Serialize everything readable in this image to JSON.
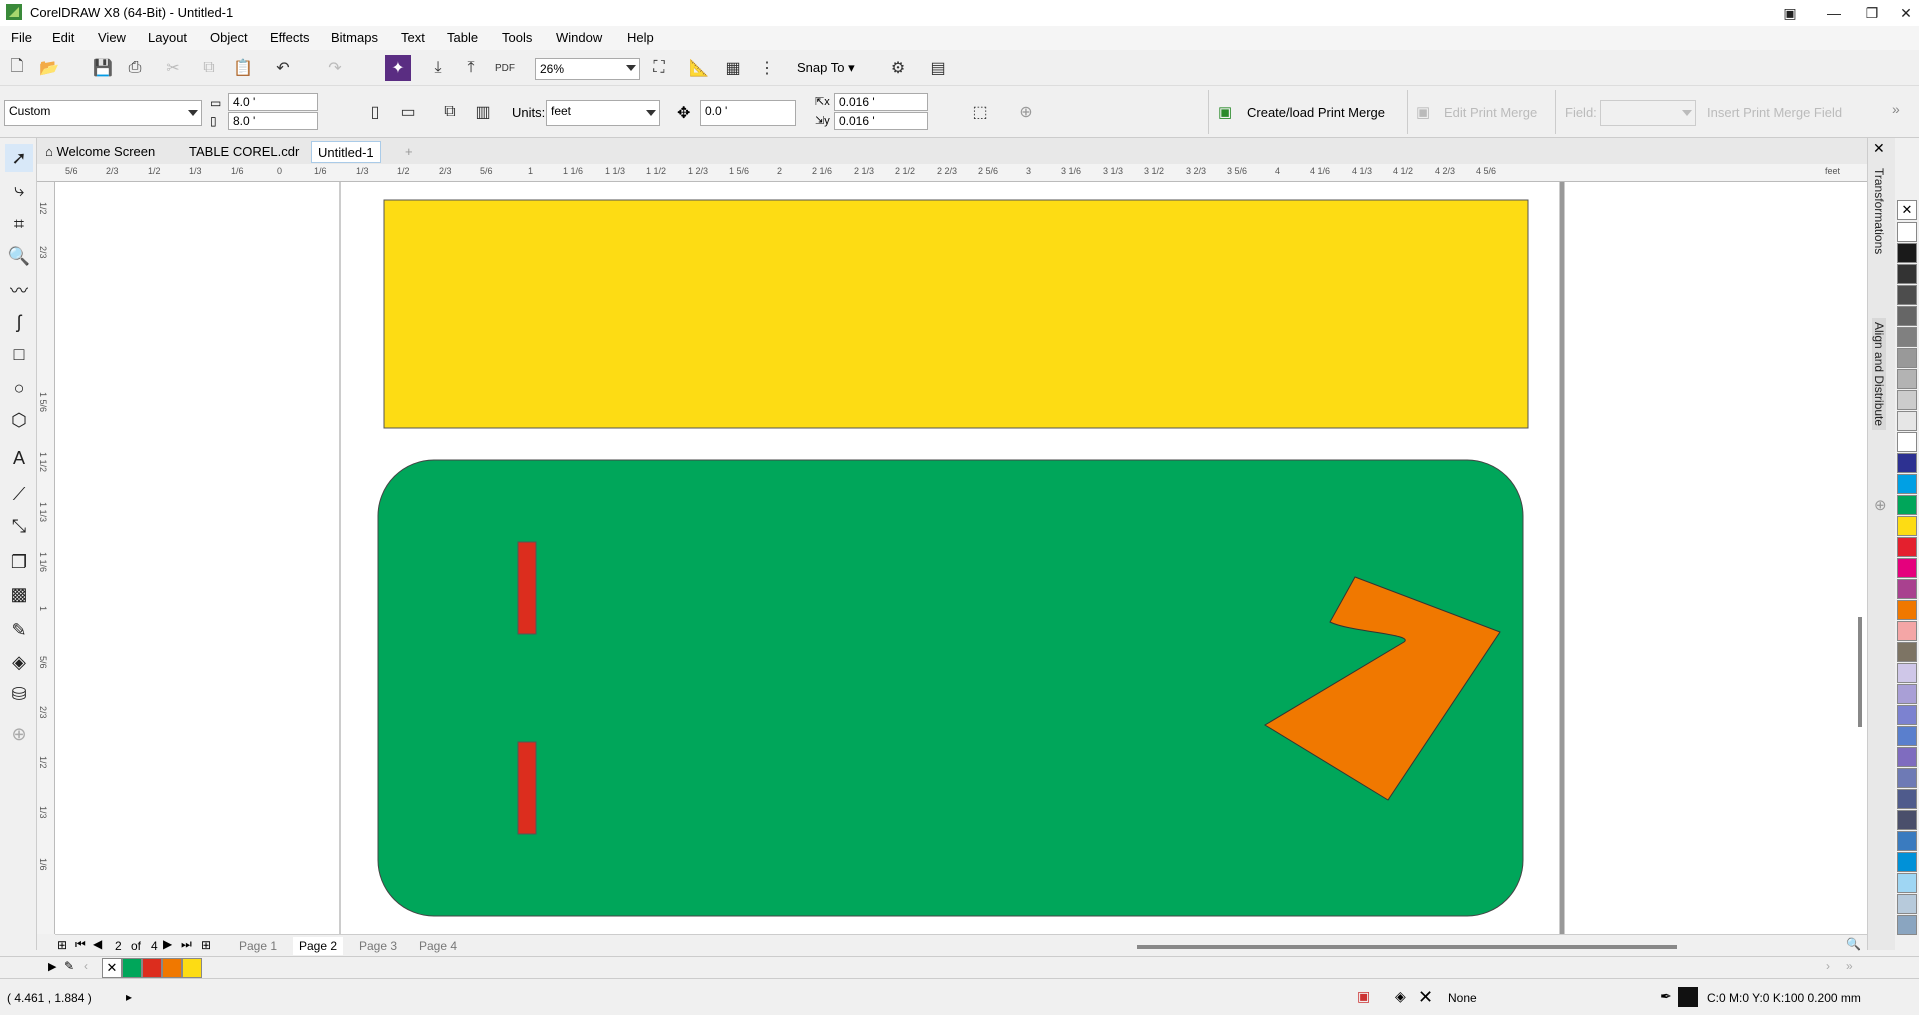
{
  "app": {
    "title": "CorelDRAW X8 (64-Bit) - Untitled-1"
  },
  "menu": [
    "File",
    "Edit",
    "View",
    "Layout",
    "Object",
    "Effects",
    "Bitmaps",
    "Text",
    "Table",
    "Tools",
    "Window",
    "Help"
  ],
  "toolbar": {
    "zoom": "26%",
    "snap_to": "Snap To",
    "page_size": "Custom",
    "width": "4.0 '",
    "height": "8.0 '",
    "units_label": "Units:",
    "units": "feet",
    "nudge": "0.0 '",
    "dup_x": "0.016 '",
    "dup_y": "0.016 '",
    "create_print_merge": "Create/load Print Merge",
    "edit_print_merge": "Edit Print Merge",
    "field_label": "Field:",
    "insert_print_merge_field": "Insert Print Merge Field"
  },
  "doc_tabs": [
    "Welcome Screen",
    "TABLE COREL.cdr",
    "Untitled-1"
  ],
  "ruler": {
    "unit": "feet",
    "h_labels": [
      "5/6",
      "2/3",
      "1/2",
      "1/3",
      "1/6",
      "0",
      "1/6",
      "1/3",
      "1/2",
      "2/3",
      "5/6",
      "1",
      "1 1/6",
      "1 1/3",
      "1 1/2",
      "1 2/3",
      "1 5/6",
      "2",
      "2 1/6",
      "2 1/3",
      "2 1/2",
      "2 2/3",
      "2 5/6",
      "3",
      "3 1/6",
      "3 1/3",
      "3 1/2",
      "3 2/3",
      "3 5/6",
      "4",
      "4 1/6",
      "4 1/3",
      "4 1/2",
      "4 2/3",
      "4 5/6"
    ],
    "v_labels": [
      "1/2",
      "2/3",
      "1 5/6",
      "1 1/2",
      "1 1/3",
      "1 1/6",
      "1",
      "5/6",
      "2/3",
      "1/2",
      "1/3",
      "1/6"
    ]
  },
  "dockers": [
    "Transformations",
    "Align and Distribute"
  ],
  "pages": {
    "current": "2",
    "of_label": "of",
    "total": "4",
    "tabs": [
      "Page 1",
      "Page 2",
      "Page 3",
      "Page 4"
    ]
  },
  "status": {
    "coords": "( 4.461 , 1.884  )",
    "fill": "None",
    "outline": "C:0 M:0 Y:0 K:100  0.200 mm"
  },
  "colors": {
    "yellow": "#FDDC14",
    "green": "#00A65A",
    "red": "#DC2D1E",
    "orange": "#F07800"
  },
  "palette": [
    "#ffffff",
    "#1a1a1a",
    "#333333",
    "#4d4d4d",
    "#666666",
    "#808080",
    "#999999",
    "#b3b3b3",
    "#cccccc",
    "#e6e6e6",
    "#ffffff",
    "#2d3191",
    "#00a0e4",
    "#00a65a",
    "#fddc14",
    "#e4202e",
    "#e5007d",
    "#a9418f",
    "#f07800",
    "#f4a6a6",
    "#7d7464",
    "#cfc7e8",
    "#a99fd6",
    "#7c82d0",
    "#5a7fcd",
    "#7f6cbf",
    "#6e7ab5",
    "#4f5b8c",
    "#4a4f6b",
    "#3a7bbf",
    "#0091d8",
    "#9fd6f3",
    "#b7cadb",
    "#8aa5c0"
  ],
  "doc_palette": [
    "#00A65A",
    "#DC2D1E",
    "#F07800",
    "#FDDC14"
  ]
}
